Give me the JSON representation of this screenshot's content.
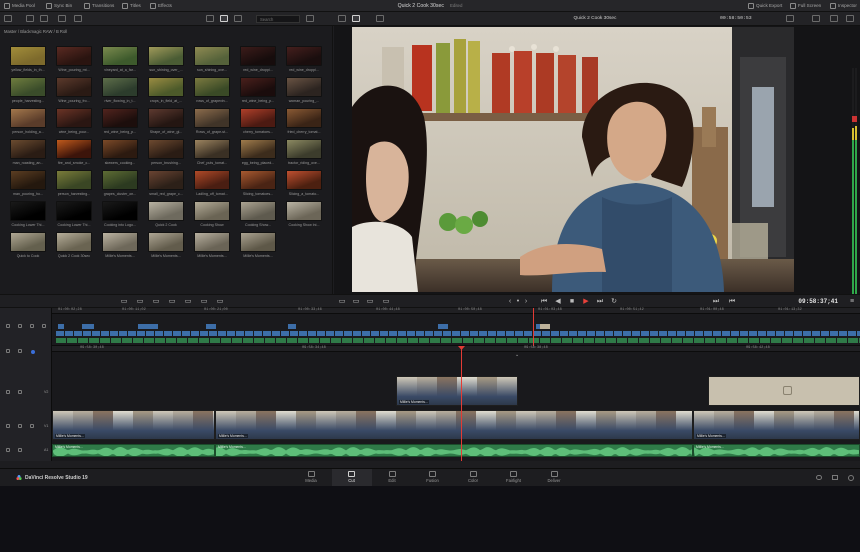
{
  "topbar": {
    "left_tabs": [
      {
        "label": "Media Pool",
        "icon": "media-pool-icon"
      },
      {
        "label": "Sync Bin",
        "icon": "sync-bin-icon"
      },
      {
        "label": "Transitions",
        "icon": "transitions-icon"
      },
      {
        "label": "Titles",
        "icon": "titles-icon"
      },
      {
        "label": "Effects",
        "icon": "effects-icon"
      }
    ],
    "project_title": "Quick 2 Cook 30sec",
    "project_status": "Edited",
    "right_items": [
      {
        "label": "Quick Export",
        "icon": "export-icon"
      },
      {
        "label": "Full Screen",
        "icon": "fullscreen-icon"
      },
      {
        "label": "Inspector",
        "icon": "inspector-icon"
      }
    ]
  },
  "toolbar": {
    "search_placeholder": "Search",
    "viewer_clip_name": "Quick 2 Cook 30sec",
    "viewer_timecode": "00:58:50:53"
  },
  "media_pool": {
    "path": "Master / Blackmagic RAW / B Roll",
    "clips": [
      {
        "name": "yellow_fields_in_th...",
        "c1": "#7d6a2c",
        "c2": "#a28d3a"
      },
      {
        "name": "Wine_pouring_mt...",
        "c1": "#2a1410",
        "c2": "#5a2a22"
      },
      {
        "name": "vineyard_at_a_far...",
        "c1": "#3d5a2c",
        "c2": "#7b8a4e"
      },
      {
        "name": "sun_shining_over_...",
        "c1": "#4a5c34",
        "c2": "#a09a5a"
      },
      {
        "name": "sun_shining_ove...",
        "c1": "#55623a",
        "c2": "#8f8a52"
      },
      {
        "name": "red_wine_droppi...",
        "c1": "#160c0c",
        "c2": "#3c1c1a"
      },
      {
        "name": "red_wine_droppi...",
        "c1": "#1a0e0e",
        "c2": "#451f1d"
      },
      {
        "name": "people_harvesting...",
        "c1": "#3a4c2a",
        "c2": "#6f7d3e"
      },
      {
        "name": "Wine_pouring_fro...",
        "c1": "#2a1a14",
        "c2": "#5c3a2c"
      },
      {
        "name": "river_flowing_in_t...",
        "c1": "#2c3c2c",
        "c2": "#5e6e4a"
      },
      {
        "name": "crops_in_field_at_...",
        "c1": "#4c5a2a",
        "c2": "#9a8c42"
      },
      {
        "name": "rows_of_grapevin...",
        "c1": "#3a4a26",
        "c2": "#7c7a40"
      },
      {
        "name": "red_wine_being_p...",
        "c1": "#1a0c0c",
        "c2": "#4a201c"
      },
      {
        "name": "woman_pouring_...",
        "c1": "#2c2420",
        "c2": "#6a5444"
      },
      {
        "name": "person_holding_a...",
        "c1": "#5a3c2a",
        "c2": "#a4784c"
      },
      {
        "name": "wine_being_pour...",
        "c1": "#2a1612",
        "c2": "#6c3426"
      },
      {
        "name": "red_wine_being_p...",
        "c1": "#1c0e0c",
        "c2": "#52241e"
      },
      {
        "name": "Shape_of_wine_gl...",
        "c1": "#241612",
        "c2": "#5e3a30"
      },
      {
        "name": "Rows_of_grape-st...",
        "c1": "#403428",
        "c2": "#8c6c4c"
      },
      {
        "name": "cherry_tomatoes...",
        "c1": "#4c1a12",
        "c2": "#b0402a"
      },
      {
        "name": "fried_cherry_tomat...",
        "c1": "#3a2416",
        "c2": "#8a5a34"
      },
      {
        "name": "man_roasting_an...",
        "c1": "#2a1c14",
        "c2": "#6c4c30"
      },
      {
        "name": "fire_and_smoke_c...",
        "c1": "#3c140a",
        "c2": "#c05a1c"
      },
      {
        "name": "skewers_cooking...",
        "c1": "#2c1a10",
        "c2": "#7c4a28"
      },
      {
        "name": "person_brushing...",
        "c1": "#2a1c14",
        "c2": "#6e4a30"
      },
      {
        "name": "Chef_puts_tomat...",
        "c1": "#3a3024",
        "c2": "#9c8460"
      },
      {
        "name": "egg_being_placed...",
        "c1": "#3c2c1c",
        "c2": "#a07c4c"
      },
      {
        "name": "tractor_riding_ove...",
        "c1": "#3c3c2c",
        "c2": "#8c8a62"
      },
      {
        "name": "man_pouring_ho...",
        "c1": "#24180e",
        "c2": "#5c3e22"
      },
      {
        "name": "person_harvesting...",
        "c1": "#3a4624",
        "c2": "#7a7c3a"
      },
      {
        "name": "grapes_cluster_on...",
        "c1": "#2c3a20",
        "c2": "#5e6c34"
      },
      {
        "name": "small_red_grape_c...",
        "c1": "#2c2018",
        "c2": "#6a4432"
      },
      {
        "name": "Ladling_off_tomat...",
        "c1": "#4a1e12",
        "c2": "#b04a28"
      },
      {
        "name": "Slicing_tomatoes...",
        "c1": "#4a2414",
        "c2": "#a85a30"
      },
      {
        "name": "Slicing_a_tomato...",
        "c1": "#4c2010",
        "c2": "#c05030"
      },
      {
        "name": "Cooking Lower Thi...",
        "c1": "#000000",
        "c2": "#1a1a1a"
      },
      {
        "name": "Cooking Lower Thi...",
        "c1": "#000000",
        "c2": "#1a1a1a"
      },
      {
        "name": "Cooking into Logo...",
        "c1": "#000000",
        "c2": "#1a1a1a"
      },
      {
        "name": "Quick 2 Cook",
        "c1": "#6e6a5e",
        "c2": "#b8b2a2"
      },
      {
        "name": "Cooking Show",
        "c1": "#6a6454",
        "c2": "#b4ac98"
      },
      {
        "name": "Cooking Show...",
        "c1": "#5e5a4e",
        "c2": "#aca492"
      },
      {
        "name": "Cooking Show Ini...",
        "c1": "#6c6658",
        "c2": "#bab4a4"
      },
      {
        "name": "Quick to Cook",
        "c1": "#64604e",
        "c2": "#b0a894"
      },
      {
        "name": "Quick 2 Cook 30sec",
        "c1": "#6a6452",
        "c2": "#b6ae9a"
      },
      {
        "name": "Millie's Moments...",
        "c1": "#6e685a",
        "c2": "#bcb4a2"
      },
      {
        "name": "Millie's Moments...",
        "c1": "#625c4c",
        "c2": "#aea694"
      },
      {
        "name": "Millie's Moments...",
        "c1": "#6a6456",
        "c2": "#b8b0a0"
      },
      {
        "name": "Millie's Moments...",
        "c1": "#5e5848",
        "c2": "#aaa290"
      }
    ]
  },
  "transport": {
    "timecode": "09:58:37;41"
  },
  "timeline_upper": {
    "ruler": [
      "01:00:02;28",
      "01:00:11;02",
      "01:00:21;00",
      "01:00:33;46",
      "01:00:44;48",
      "01:00:50;48",
      "01:01:03;48",
      "01:00:51;42",
      "01:01:00;48",
      "01:01:13;32"
    ]
  },
  "timeline_lower": {
    "ruler": [
      "09:58:30;48",
      "09:58:34;48",
      "09:58:38;48",
      "09:58:42;48"
    ],
    "tracks": [
      {
        "id": "V2"
      },
      {
        "id": "V1"
      },
      {
        "id": "A1"
      }
    ],
    "v2_clip_label": "Millie's Moments...",
    "v1_clips": [
      "Millie's Moments...",
      "Millie's Moments...",
      "Millie's Moments..."
    ],
    "a1_clips": [
      "Millie's Moments...",
      "Millie's Moments...",
      "Millie's Moments..."
    ]
  },
  "pages": [
    {
      "label": "Media",
      "icon": "media-page-icon",
      "active": false
    },
    {
      "label": "Cut",
      "icon": "cut-page-icon",
      "active": true
    },
    {
      "label": "Edit",
      "icon": "edit-page-icon",
      "active": false
    },
    {
      "label": "Fusion",
      "icon": "fusion-page-icon",
      "active": false
    },
    {
      "label": "Color",
      "icon": "color-page-icon",
      "active": false
    },
    {
      "label": "Fairlight",
      "icon": "fairlight-page-icon",
      "active": false
    },
    {
      "label": "Deliver",
      "icon": "deliver-page-icon",
      "active": false
    }
  ],
  "brand": {
    "name": "DaVinci Resolve Studio 19"
  },
  "colors": {
    "accent_red": "#e33b35",
    "audio_green": "#2f7a48",
    "timeline_blue": "#3d6ea8"
  }
}
